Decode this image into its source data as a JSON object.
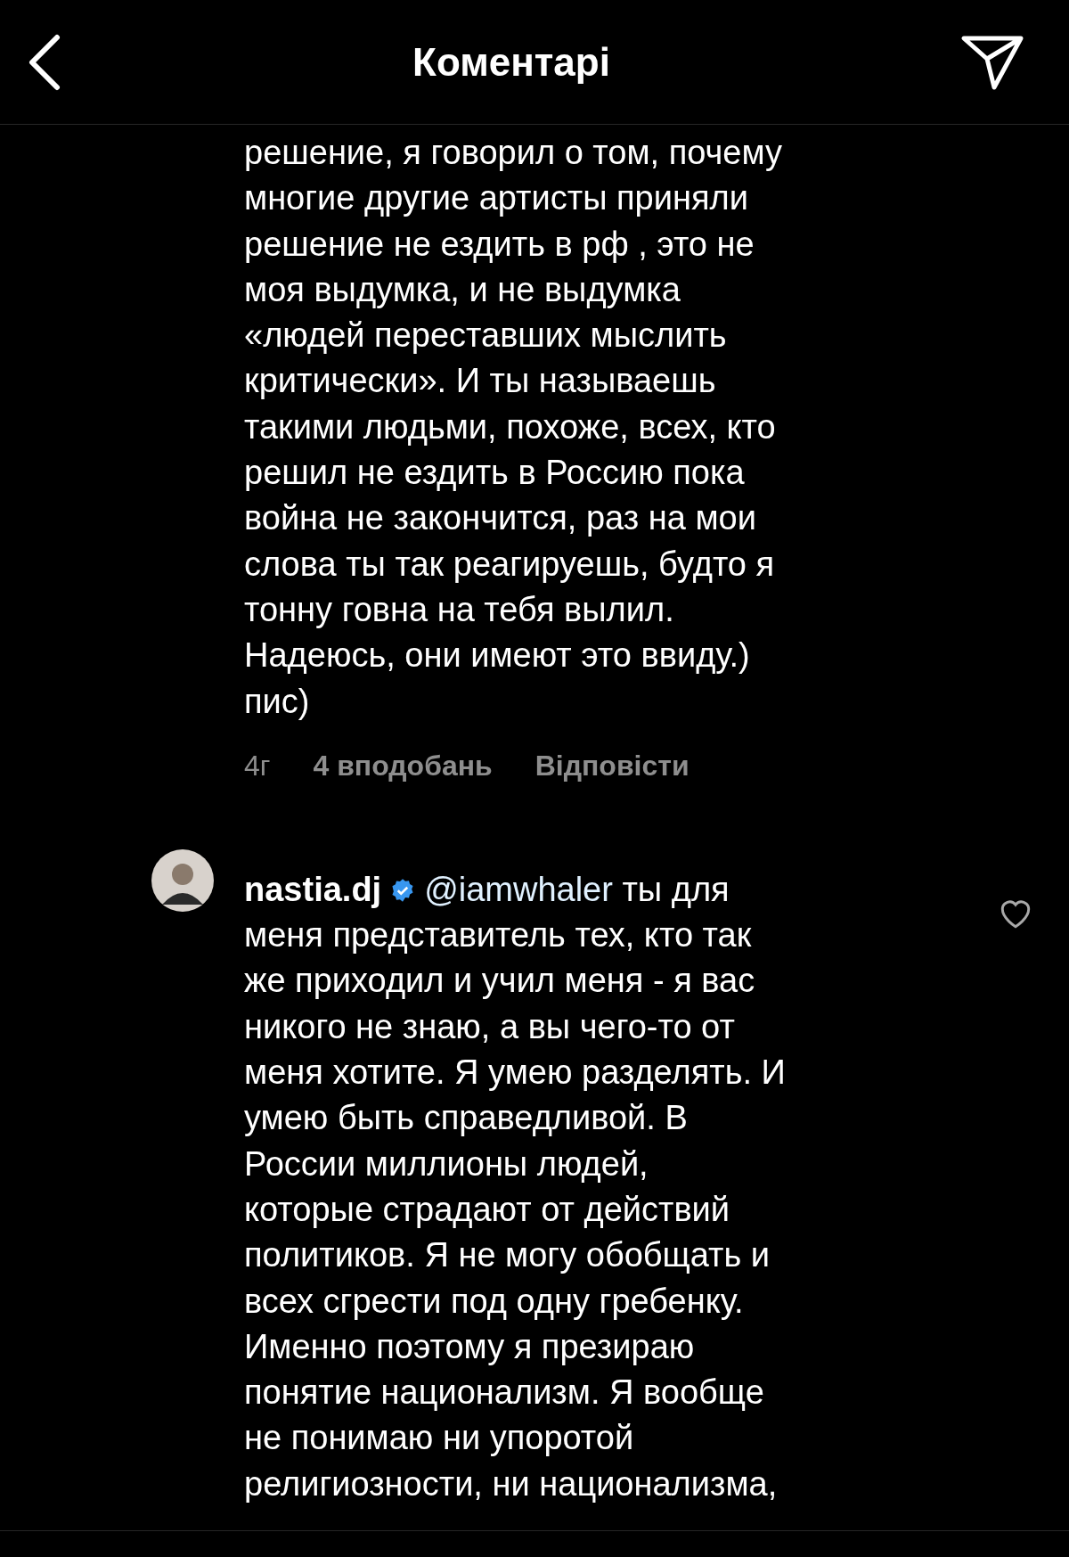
{
  "header": {
    "title": "Коментарі"
  },
  "comments": [
    {
      "text": "решение, я говорил о том, почему\nмногие другие артисты приняли\nрешение не ездить в рф , это не\nмоя выдумка, и не выдумка\n«людей переставших мыслить\nкритически». И ты называешь\nтакими людьми, похоже, всех, кто\nрешил не ездить в Россию пока\nвойна не закончится, раз на мои\nслова ты так реагируешь, будто я\nтонну говна на тебя вылил.\nНадеюсь, они имеют это ввиду.)\nпис)",
      "meta": {
        "time": "4г",
        "likes": "4 вподобань",
        "reply": "Відповісти"
      }
    },
    {
      "username": "nastia.dj",
      "verified": true,
      "mention": "@iamwhaler",
      "liked": false,
      "text": "ты для\nменя представитель тех, кто так\nже приходил и учил меня - я вас\nникого не знаю, а вы чего-то от\nменя хотите. Я умею разделять. И\nумею быть справедливой. В\nРоссии миллионы людей,\nкоторые страдают от действий\nполитиков. Я не могу обобщать и\nвсех сгрести под одну гребенку.\nИменно поэтому я презираю\nпонятие национализм. Я вообще\nне понимаю ни упоротой\nрелигиозности, ни национализма,"
    }
  ]
}
